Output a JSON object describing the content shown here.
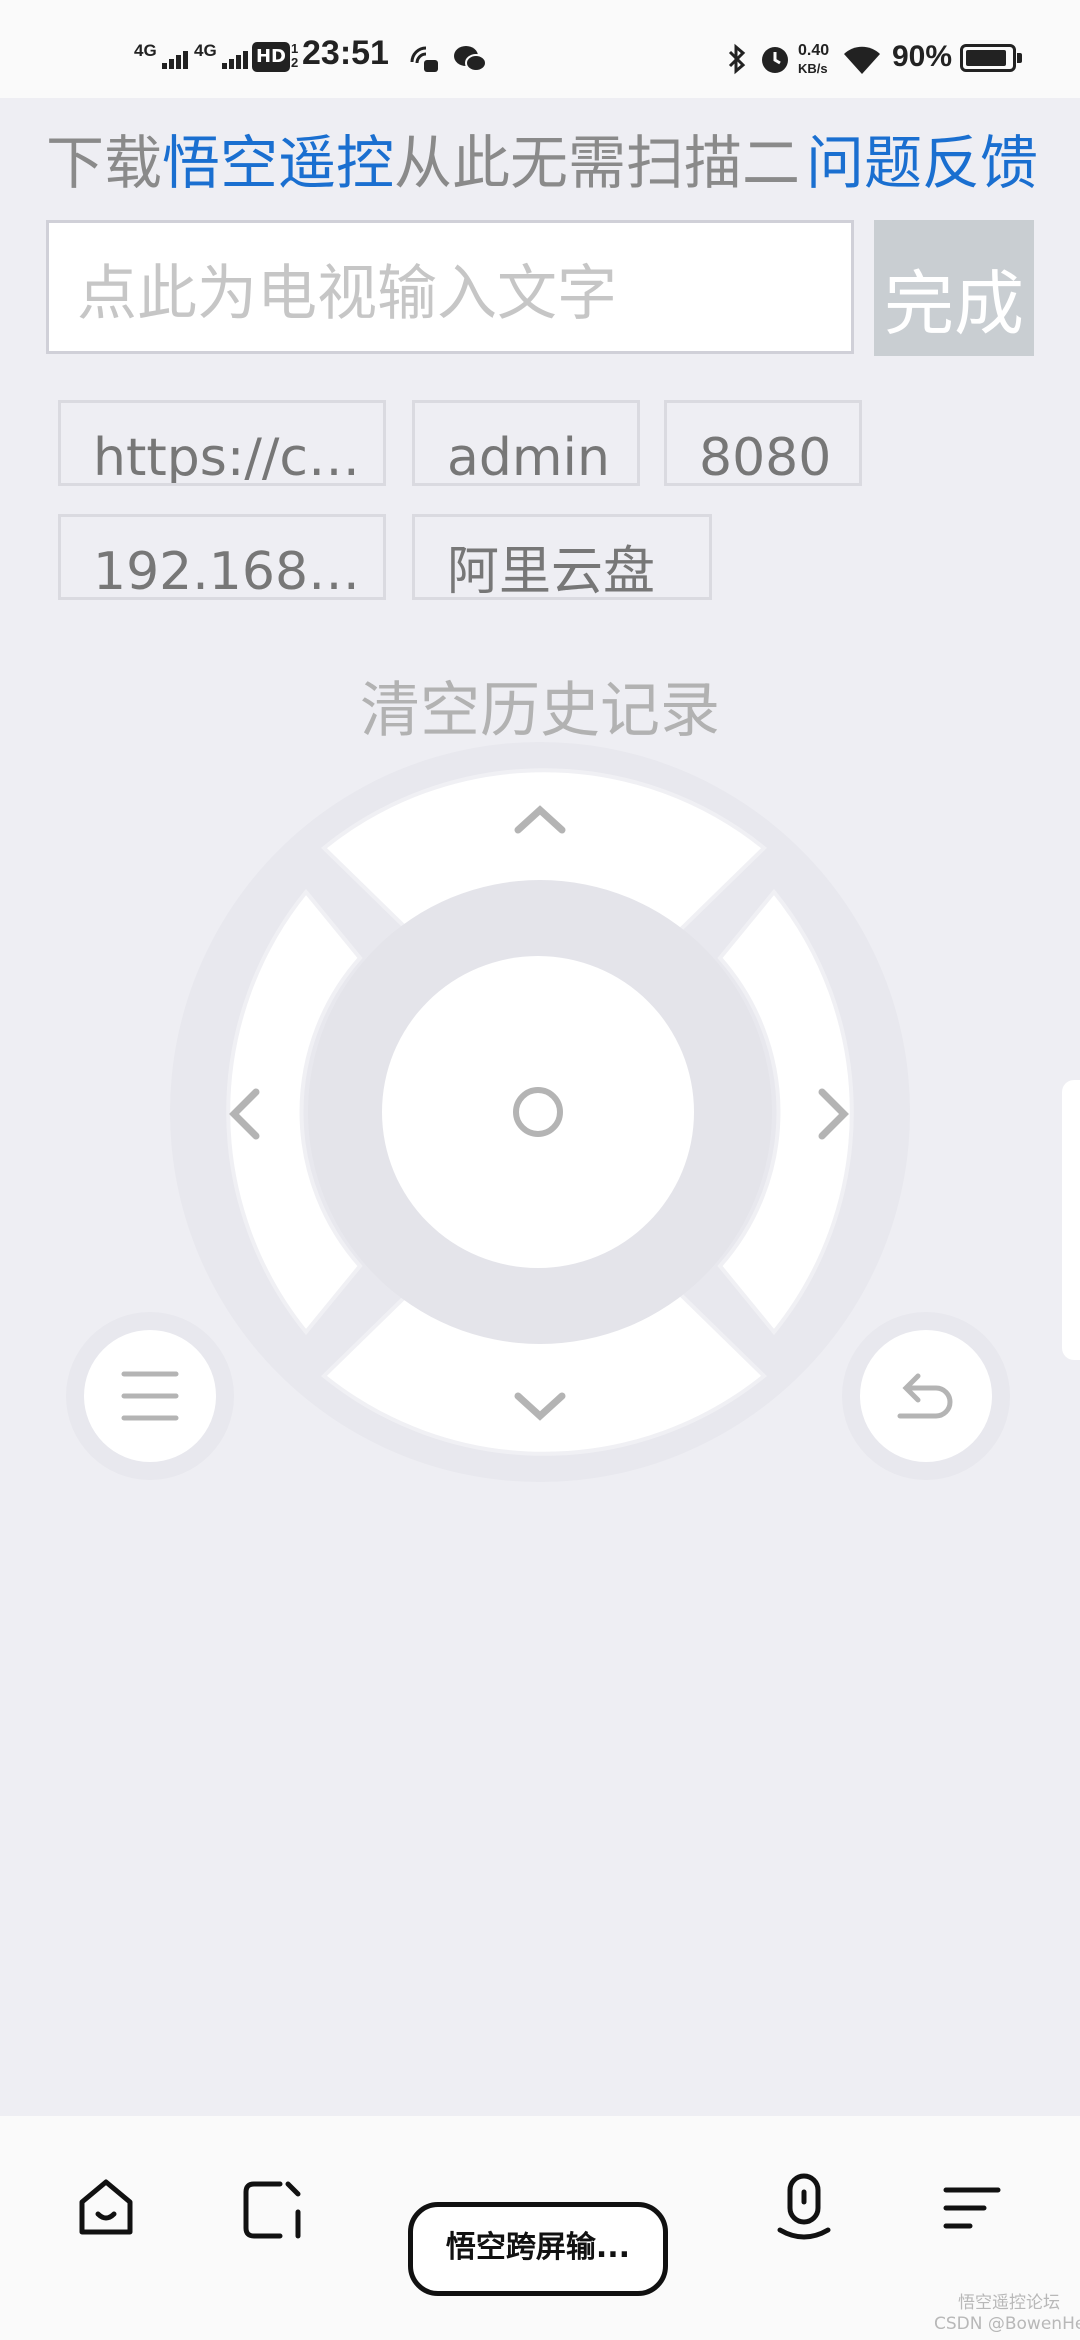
{
  "status_bar": {
    "net1": "4G",
    "net2": "4G",
    "hd": "HD",
    "hd_sub": "1 2",
    "time": "23:51",
    "speed_value": "0.40",
    "speed_unit": "KB/s",
    "battery": "90%",
    "battery_level": 0.9
  },
  "header": {
    "prefix": "下载",
    "app_link": "悟空遥控",
    "suffix": "从此无需扫描二",
    "feedback": "问题反馈"
  },
  "input": {
    "placeholder": "点此为电视输入文字",
    "value": "",
    "done_label": "完成"
  },
  "history": {
    "chips": [
      "https://c…",
      "admin",
      "8080",
      "192.168…",
      "阿里云盘"
    ],
    "clear_label": "清空历史记录"
  },
  "remote": {
    "icons": [
      "chevron-up-icon",
      "chevron-down-icon",
      "chevron-left-icon",
      "chevron-right-icon",
      "ok-circle-icon",
      "menu-icon",
      "back-icon"
    ]
  },
  "bottom_nav": {
    "center_label": "悟空跨屏输...",
    "icons": [
      "home-icon",
      "tabs-icon",
      "microphone-icon",
      "sort-menu-icon"
    ]
  },
  "watermark": {
    "line1": "悟空遥控论坛",
    "line2": "CSDN @BowenHero"
  },
  "colors": {
    "background": "#eeeef3",
    "accent_blue": "#1a6fd0",
    "done_button": "#c9ced2"
  }
}
